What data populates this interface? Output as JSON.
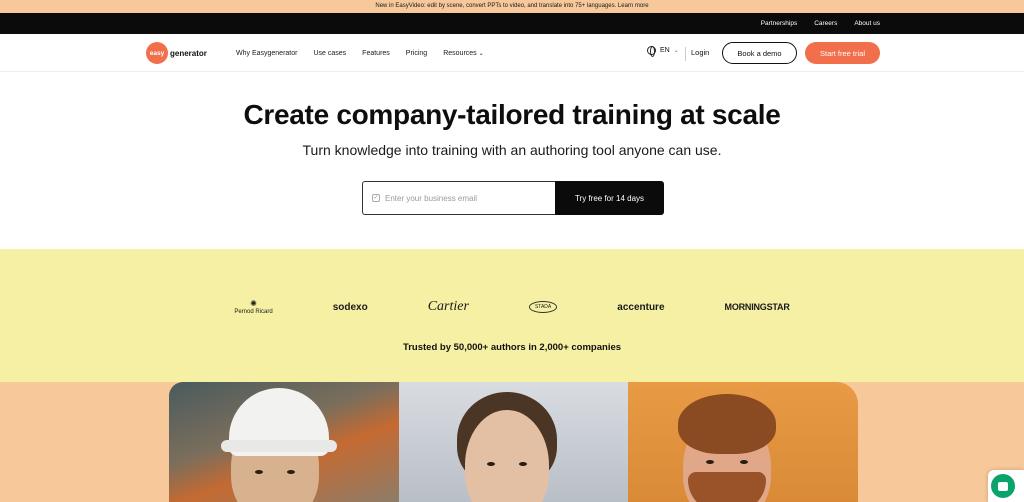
{
  "announcement": "New in EasyVideo: edit by scene, convert PPTs to video, and translate into 75+ languages. Learn more",
  "topbar": {
    "links": [
      "Partnerships",
      "Careers",
      "About us"
    ]
  },
  "nav": {
    "logo_badge": "easy",
    "logo_text": "generator",
    "items": [
      "Why Easygenerator",
      "Use cases",
      "Features",
      "Pricing",
      "Resources"
    ],
    "language": "EN",
    "login": "Login",
    "book_demo": "Book a demo",
    "start_trial": "Start free trial"
  },
  "hero": {
    "title": "Create company-tailored training at scale",
    "subtitle": "Turn knowledge into training with an authoring tool anyone can use.",
    "email_placeholder": "Enter your business email",
    "cta": "Try free for 14 days"
  },
  "logos": {
    "brands": [
      "Pernod Ricard",
      "sodexo",
      "Cartier",
      "STADA",
      "accenture",
      "MORNINGSTAR"
    ],
    "trusted": "Trusted by 50,000+ authors in 2,000+ companies"
  },
  "colors": {
    "accent": "#f26f4c",
    "logo_band": "#f6f0a4",
    "peach": "#f6c89a",
    "chat": "#0aa36c"
  }
}
